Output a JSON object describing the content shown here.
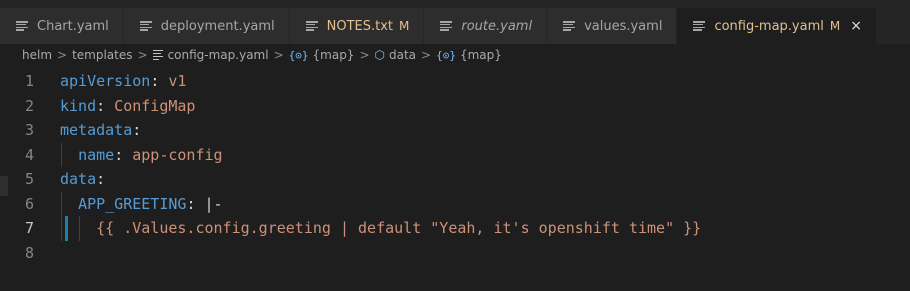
{
  "tabs": [
    {
      "label": "Chart.yaml",
      "badge": "",
      "italic": false,
      "active": false,
      "modified": false
    },
    {
      "label": "deployment.yaml",
      "badge": "",
      "italic": false,
      "active": false,
      "modified": false
    },
    {
      "label": "NOTES.txt",
      "badge": "M",
      "italic": false,
      "active": false,
      "modified": true
    },
    {
      "label": "route.yaml",
      "badge": "",
      "italic": true,
      "active": false,
      "modified": false
    },
    {
      "label": "values.yaml",
      "badge": "",
      "italic": false,
      "active": false,
      "modified": false
    },
    {
      "label": "config-map.yaml",
      "badge": "M",
      "italic": false,
      "active": true,
      "modified": true
    }
  ],
  "close_glyph": "×",
  "breadcrumb": {
    "items": [
      "helm",
      "templates",
      "config-map.yaml",
      "{map}",
      "data",
      "{map}"
    ],
    "separator": ">",
    "map_icon": "{⊙}"
  },
  "editor": {
    "lines": [
      {
        "number": "1",
        "key": "apiVersion",
        "colon": ":",
        "value": " v1",
        "indent": ""
      },
      {
        "number": "2",
        "key": "kind",
        "colon": ":",
        "value": " ConfigMap",
        "indent": ""
      },
      {
        "number": "3",
        "key": "metadata",
        "colon": ":",
        "value": "",
        "indent": ""
      },
      {
        "number": "4",
        "key": "name",
        "colon": ":",
        "value": " app-config",
        "indent": "  "
      },
      {
        "number": "5",
        "key": "data",
        "colon": ":",
        "value": "",
        "indent": ""
      },
      {
        "number": "6",
        "key": "APP_GREETING",
        "colon": ":",
        "value": " |-",
        "indent": "  "
      },
      {
        "number": "7",
        "key": "",
        "colon": "",
        "value": "{{ .Values.config.greeting | default \"Yeah, it's openshift time\" }}",
        "indent": "    "
      },
      {
        "number": "8",
        "key": "",
        "colon": "",
        "value": "",
        "indent": ""
      }
    ],
    "current_line": "7"
  },
  "colors": {
    "key": "#569cd6",
    "string": "#ce9178",
    "modified": "#e2c08d",
    "background": "#1e1e1e"
  }
}
